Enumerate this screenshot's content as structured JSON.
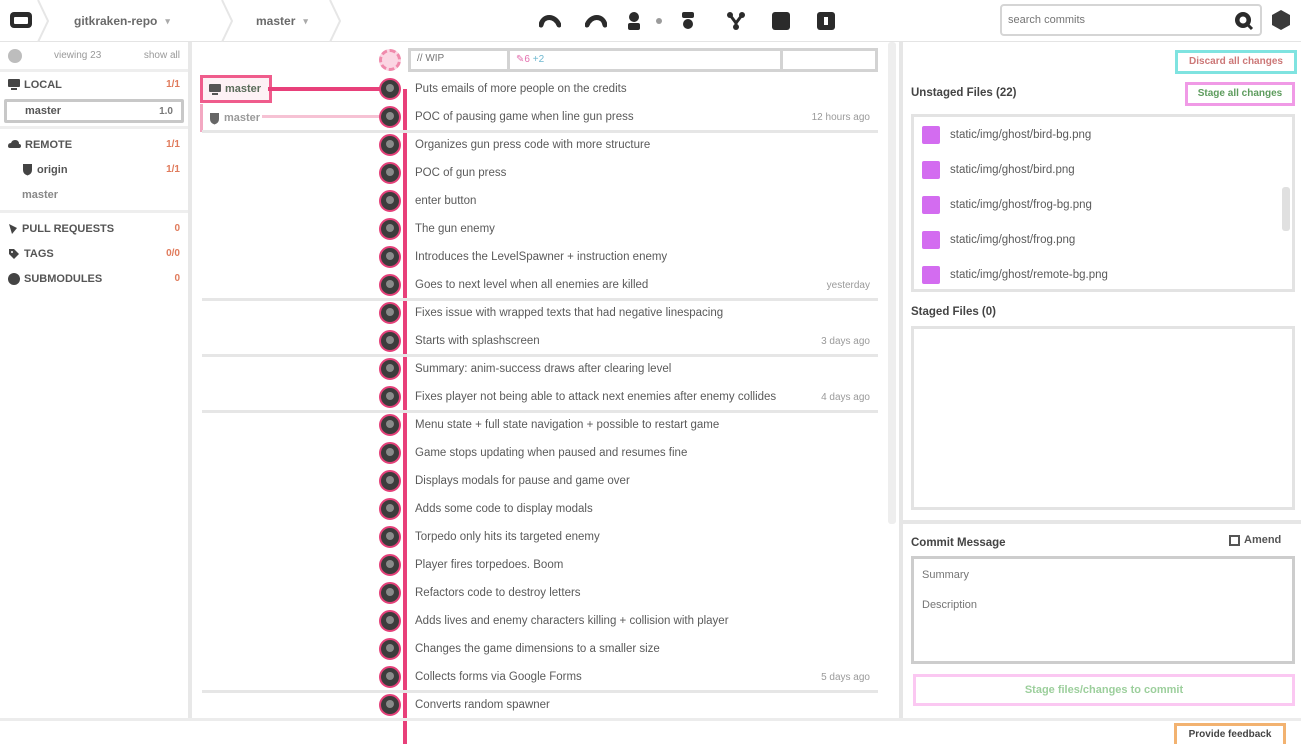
{
  "topbar": {
    "repo_icon": "folder-icon",
    "repo_name": "gitkraken-repo",
    "branch_name": "master",
    "chevron": "▾",
    "toolbar": [
      {
        "name": "undo-icon"
      },
      {
        "name": "redo-icon"
      },
      {
        "name": "pull-icon"
      },
      {
        "name": "push-icon"
      },
      {
        "name": "branch-icon"
      },
      {
        "name": "stash-icon"
      },
      {
        "name": "pop-icon"
      }
    ],
    "search_placeholder": "search commits"
  },
  "sidebar": {
    "header": {
      "mid": "viewing 23",
      "right": "show all"
    },
    "local": {
      "label": "LOCAL",
      "count": "1/1"
    },
    "selected_branch": {
      "label": "master",
      "count": "1.0"
    },
    "remote": {
      "label": "REMOTE",
      "count": "1/1"
    },
    "remote_origin": {
      "label": "origin",
      "count": "1/1"
    },
    "remote_branch": {
      "label": "master"
    },
    "pull_requests": {
      "label": "PULL REQUESTS",
      "count": "0"
    },
    "tags": {
      "label": "TAGS",
      "count": "0/0"
    },
    "submodules": {
      "label": "SUBMODULES",
      "count": "0"
    }
  },
  "graph": {
    "wip_placeholder": "// WIP",
    "wip_edit": "✎6",
    "wip_add": "+2",
    "branch_local": "master",
    "branch_remote": "master",
    "commits": [
      {
        "msg": "Puts emails of more people on the credits",
        "when": ""
      },
      {
        "msg": "POC of pausing game when line gun press",
        "when": "12 hours ago"
      },
      {
        "msg": "Organizes gun press code with more structure",
        "when": ""
      },
      {
        "msg": "POC of gun press",
        "when": ""
      },
      {
        "msg": "enter button",
        "when": ""
      },
      {
        "msg": "The gun enemy",
        "when": ""
      },
      {
        "msg": "Introduces the LevelSpawner + instruction enemy",
        "when": ""
      },
      {
        "msg": "Goes to next level when all enemies are killed",
        "when": "yesterday"
      },
      {
        "msg": "Fixes issue with wrapped texts that had negative linespacing",
        "when": ""
      },
      {
        "msg": "Starts with splashscreen",
        "when": "3 days ago"
      },
      {
        "msg": "Summary: anim-success draws after clearing level",
        "when": ""
      },
      {
        "msg": "Fixes player not being able to attack next enemies after enemy collides",
        "when": "4 days ago"
      },
      {
        "msg": "Menu state + full state navigation + possible to restart game",
        "when": ""
      },
      {
        "msg": "Game stops updating when paused and resumes fine",
        "when": ""
      },
      {
        "msg": "Displays modals for pause and game over",
        "when": ""
      },
      {
        "msg": "Adds some code to display modals",
        "when": ""
      },
      {
        "msg": "Torpedo only hits its targeted enemy",
        "when": ""
      },
      {
        "msg": "Player fires torpedoes. Boom",
        "when": ""
      },
      {
        "msg": "Refactors code to destroy letters",
        "when": ""
      },
      {
        "msg": "Adds lives and enemy characters killing + collision with player",
        "when": ""
      },
      {
        "msg": "Changes the game dimensions to a smaller size",
        "when": ""
      },
      {
        "msg": "Collects forms via Google Forms",
        "when": "5 days ago"
      },
      {
        "msg": "Converts random spawner",
        "when": ""
      }
    ]
  },
  "rpanel": {
    "discard_label": "Discard all changes",
    "unstaged_title": "Unstaged Files (22)",
    "stage_all_label": "Stage all changes",
    "unstaged_files": [
      "static/img/ghost/bird-bg.png",
      "static/img/ghost/bird.png",
      "static/img/ghost/frog-bg.png",
      "static/img/ghost/frog.png",
      "static/img/ghost/remote-bg.png"
    ],
    "staged_title": "Staged Files (0)",
    "commit_title": "Commit Message",
    "amend_label": "Amend",
    "summary_placeholder": "Summary",
    "description_placeholder": "Description",
    "commit_btn_label": "Stage files/changes to commit"
  },
  "footer": {
    "feedback_label": "Provide feedback"
  }
}
